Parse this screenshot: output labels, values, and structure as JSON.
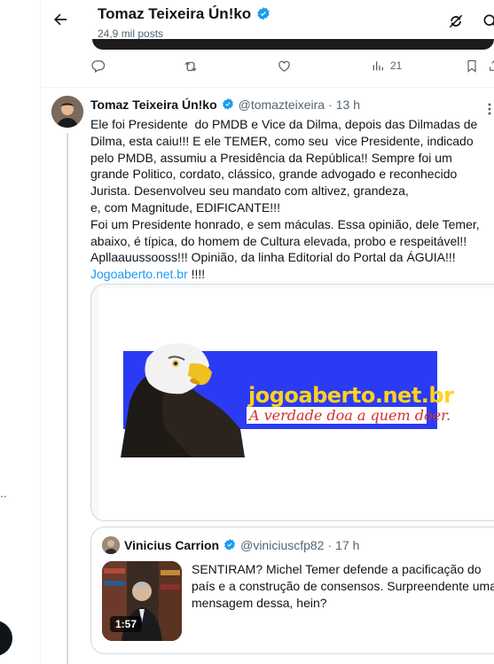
{
  "header": {
    "title": "Tomaz Teixeira Ún!ko",
    "subtitle": "24,9 mil posts"
  },
  "prev_actions": {
    "views": "21"
  },
  "tweet": {
    "author_name": "Tomaz Teixeira Ún!ko",
    "handle": "@tomazteixeira",
    "separator": "·",
    "time": "13 h",
    "text_main": "Ele foi Presidente  do PMDB e Vice da Dilma, depois das Dilmadas de Dilma, esta caiu!!! E ele TEMER, como seu  vice Presidente, indicado pelo PMDB, assumiu a Presidência da República!! Sempre foi um grande Politico, cordato, clássico, grande advogado e reconhecido Jurista. Desenvolveu seu mandato com altivez, grandeza,\ne, com Magnitude, EDIFICANTE!!!\nFoi um Presidente honrado, e sem máculas. Essa opinião, dele Temer, abaixo, é típica, do homem de Cultura elevada, probo e respeitável!! Apllaauussooss!!! Opinião, da linha Editorial do Portal da ÁGUIA!!!\n",
    "link": "Jogoaberto.net.br",
    "text_after_link": " !!!!"
  },
  "media": {
    "banner_title": "jogoaberto.net.br",
    "banner_tagline": "A verdade doa a quem doer."
  },
  "quote": {
    "author_name": "Vinicius Carrion",
    "handle": "@viniciuscfp82",
    "separator": "·",
    "time": "17 h",
    "text": "SENTIRAM? Michel Temer defende a pacificação do país e a construção de consensos. Surpreendente uma mensagem dessa, hein?",
    "video_duration": "1:57"
  },
  "colors": {
    "accent": "#1d9bf0",
    "verified": "#1d9bf0",
    "banner_blue": "#2b3bf3",
    "banner_yellow": "#ffd21f",
    "tag_red": "#d42d2d"
  }
}
